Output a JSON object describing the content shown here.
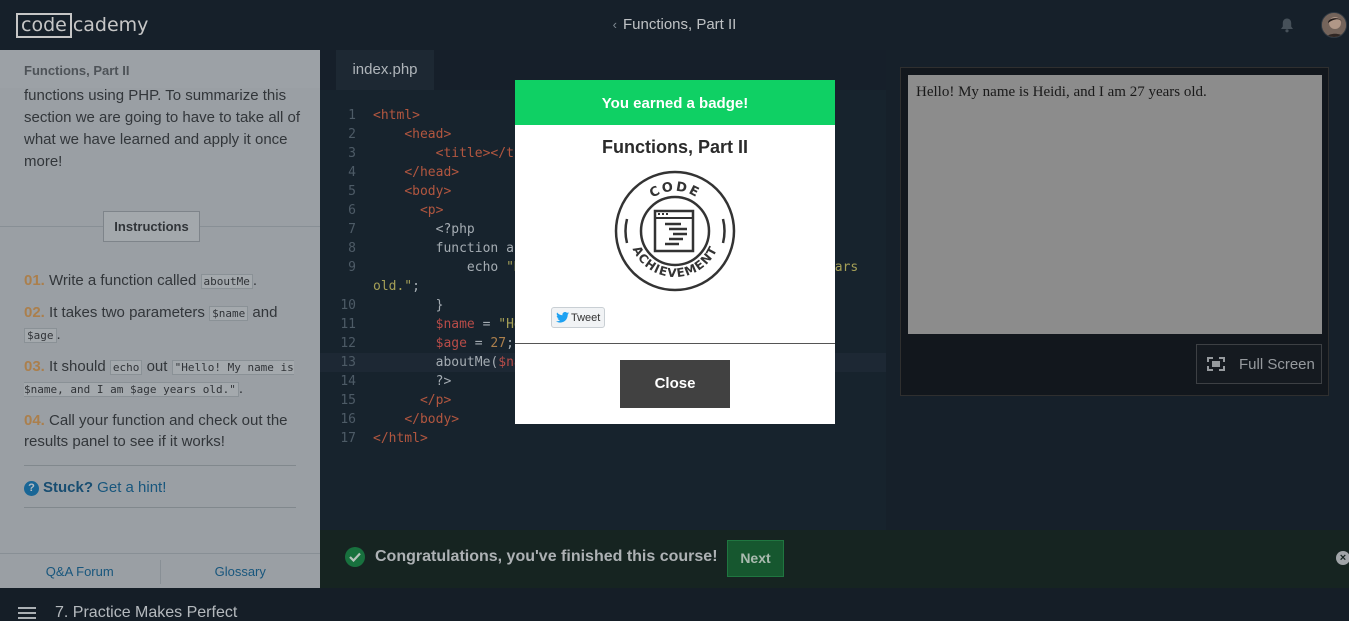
{
  "app": {
    "logo_box": "code",
    "logo_rest": "cademy"
  },
  "header": {
    "back_chevron": "‹",
    "title": "Functions, Part II"
  },
  "left_panel": {
    "heading": "Functions, Part II",
    "intro": "functions using PHP. To summarize this section we are going to have to take all of what we have learned and apply it once more!",
    "instructions_label": "Instructions",
    "steps": [
      {
        "num": "01.",
        "before": "Write a function called ",
        "code": "aboutMe",
        "after": "."
      },
      {
        "num": "02.",
        "before": "It takes two parameters ",
        "code": "$name",
        "mid": " and ",
        "code2": "$age",
        "after": "."
      },
      {
        "num": "03.",
        "before": "It should ",
        "code": "echo",
        "mid": " out ",
        "code2": "\"Hello! My name is $name, and I am $age years old.\"",
        "after": "."
      },
      {
        "num": "04.",
        "before": "Call your function and check out the results panel to see if it works!"
      }
    ],
    "hint_bold": "Stuck?",
    "hint_text": " Get a hint!",
    "footer_links": [
      "Q&A Forum",
      "Glossary"
    ]
  },
  "editor": {
    "tab": "index.php",
    "line_numbers": [
      "1",
      "2",
      "3",
      "4",
      "5",
      "6",
      "7",
      "8",
      "9",
      "",
      "10",
      "11",
      "12",
      "13",
      "14",
      "15",
      "16",
      "17"
    ]
  },
  "results": {
    "output": "Hello! My name is Heidi, and I am 27 years old.",
    "fullscreen_label": "Full Screen"
  },
  "congrats_bar": {
    "message": "Congratulations, you've finished this course!",
    "next_label": "Next",
    "close_glyph": "×"
  },
  "bottom_nav": {
    "lesson": "7. Practice Makes Perfect"
  },
  "modal": {
    "header": "You earned a badge!",
    "badge_title": "Functions, Part II",
    "badge_top_text": "CODE",
    "badge_bottom_text": "ACHIEVEMENT",
    "tweet_label": "Tweet",
    "close_label": "Close"
  },
  "colors": {
    "modal_header": "#0fd064",
    "next_button": "#1b6b3a",
    "link": "#1e6a99",
    "topbar": "#1c2834"
  }
}
